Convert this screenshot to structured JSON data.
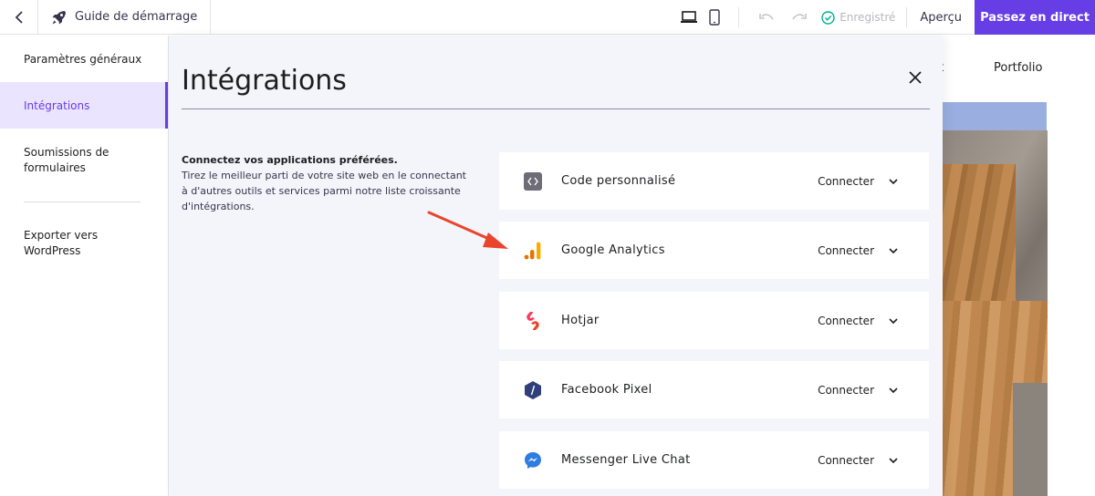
{
  "topbar": {
    "guide_label": "Guide de démarrage",
    "saved_label": "Enregistré",
    "preview_label": "Aperçu",
    "publish_label": "Passez en direct"
  },
  "sidebar": {
    "items": [
      {
        "label": "Paramètres généraux"
      },
      {
        "label": "Intégrations"
      },
      {
        "label": "Soumissions de formulaires"
      },
      {
        "label": "Exporter vers WordPress"
      }
    ]
  },
  "modal": {
    "title": "Intégrations",
    "intro_heading": "Connectez vos applications préférées.",
    "intro_body": "Tirez le meilleur parti de votre site web en le connectant à d'autres outils et services parmi notre liste croissante d'intégrations.",
    "integrations": [
      {
        "name": "Code personnalisé",
        "action": "Connecter",
        "icon": "code-icon"
      },
      {
        "name": "Google Analytics",
        "action": "Connecter",
        "icon": "google-analytics-icon"
      },
      {
        "name": "Hotjar",
        "action": "Connecter",
        "icon": "hotjar-icon"
      },
      {
        "name": "Facebook Pixel",
        "action": "Connecter",
        "icon": "facebook-pixel-icon"
      },
      {
        "name": "Messenger Live Chat",
        "action": "Connecter",
        "icon": "messenger-icon"
      }
    ]
  },
  "preview": {
    "nav_partial": "ct",
    "nav_portfolio": "Portfolio"
  },
  "colors": {
    "accent": "#673de6",
    "accent_light": "#ebe4ff",
    "saved_green": "#00b090",
    "arrow": "#e8452c"
  }
}
